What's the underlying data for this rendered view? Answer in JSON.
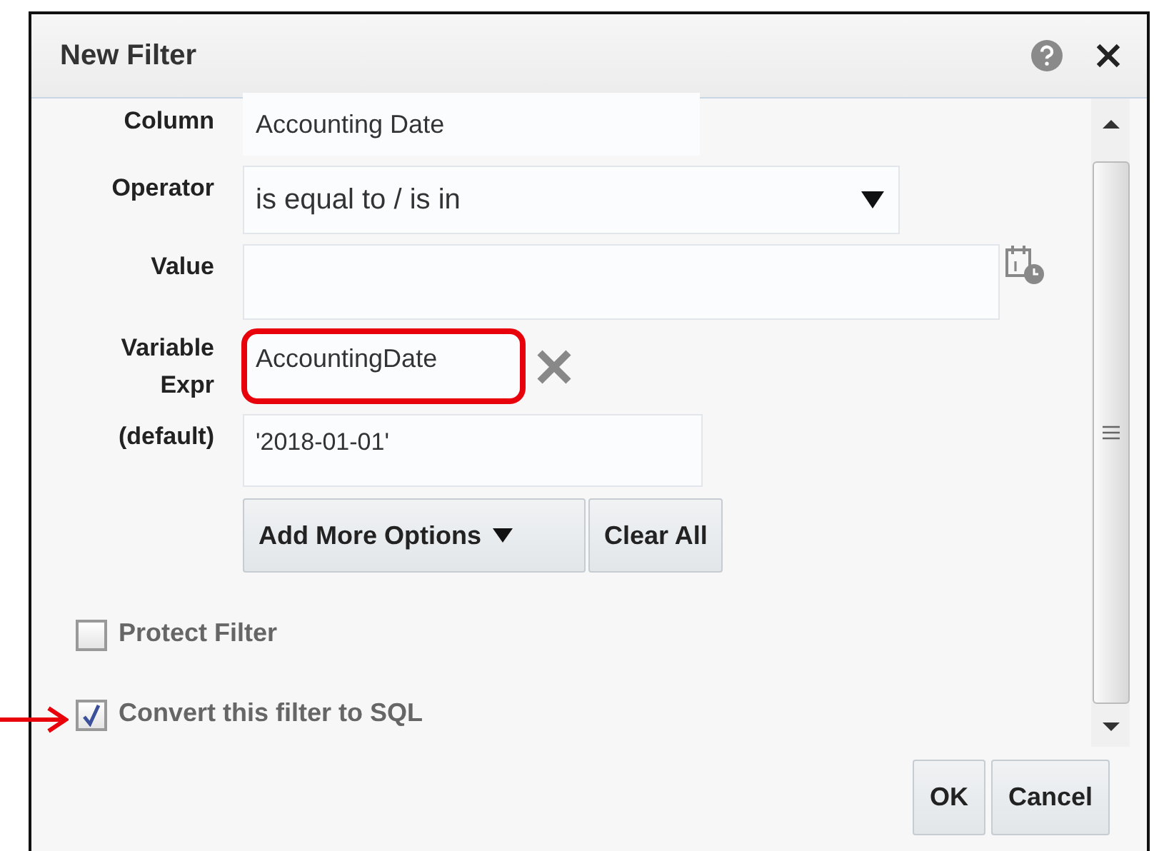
{
  "window": {
    "title": "New Filter"
  },
  "fields": [
    {
      "kind": "readonly",
      "label": "Column",
      "value": "Accounting Date"
    },
    {
      "kind": "dropdown",
      "label": "Operator",
      "value": "is equal to / is in"
    },
    {
      "kind": "date",
      "label": "Value"
    },
    {
      "kind": "variable",
      "label": "Variable Expr",
      "value": "AccountingDate",
      "highlighted": true
    },
    {
      "kind": "text",
      "label": "(default)",
      "value": "'2018-01-01'"
    }
  ],
  "option_buttons": [
    {
      "label": "Add More Options",
      "dropdown": true
    },
    {
      "label": "Clear All",
      "dropdown": false
    }
  ],
  "checkboxes": [
    {
      "label": "Protect Filter",
      "checked": false,
      "pointed": false
    },
    {
      "label": "Convert this filter to SQL",
      "checked": true,
      "pointed": true
    }
  ],
  "buttons": [
    "OK",
    "Cancel"
  ]
}
